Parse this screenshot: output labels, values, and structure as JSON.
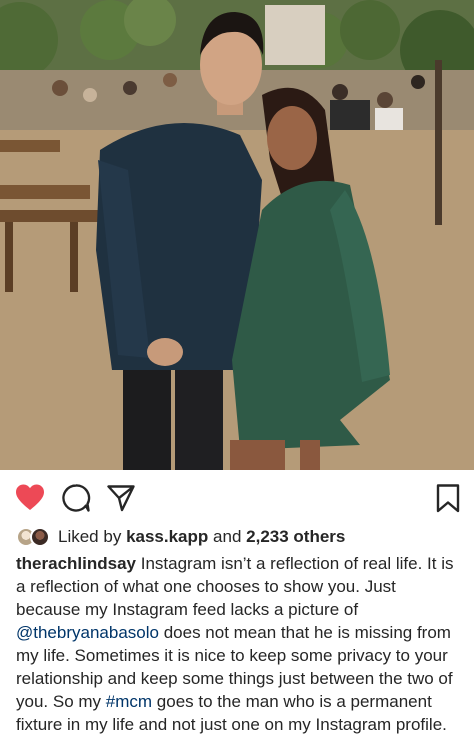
{
  "post": {
    "photo_alt": "",
    "actions": {
      "liked": true,
      "like_color": "#ed4956"
    },
    "likes": {
      "prefix": "Liked by",
      "first_liker": "kass.kapp",
      "middle": "and",
      "others": "2,233 others"
    },
    "caption": {
      "username": "therachlindsay",
      "part1": "Instagram isn’t a reflection of real life. It is a reflection of what one chooses to show you. Just because my Instagram feed lacks a picture of",
      "mention": "@thebryanabasolo",
      "part2": "does not mean that he is missing from my life. Sometimes it is nice to keep some privacy to your relationship and keep some things just between the two of you. So my",
      "hashtag": "#mcm",
      "part3": "goes to the man who is a permanent fixture in my life and not just one on my Instagram profile."
    }
  }
}
